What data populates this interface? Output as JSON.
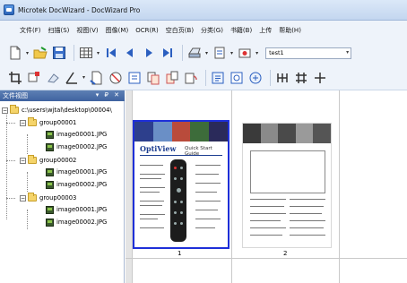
{
  "window": {
    "title": "Microtek DocWizard - DocWizard Pro"
  },
  "menu": [
    "文件(F)",
    "扫描(S)",
    "视图(V)",
    "图像(M)",
    "OCR(R)",
    "空白页(B)",
    "分类(G)",
    "书籍(B)",
    "上传",
    "帮助(H)"
  ],
  "toolbar": {
    "profile_value": "test1"
  },
  "panel": {
    "title": "文件视图",
    "controls": "▾ ₽ ✕"
  },
  "tree": {
    "root": "c:\\users\\wjtal\\desktop\\00004\\",
    "groups": [
      {
        "label": "group00001",
        "files": [
          "image00001.JPG",
          "image00002.JPG"
        ]
      },
      {
        "label": "group00002",
        "files": [
          "image00001.JPG",
          "image00002.JPG"
        ]
      },
      {
        "label": "group00003",
        "files": [
          "image00001.JPG",
          "image00002.JPG"
        ]
      }
    ]
  },
  "thumbnails": [
    {
      "number": "1",
      "brand": "OptiView",
      "heading": "Quick Start Guide",
      "selected": true
    },
    {
      "number": "2",
      "selected": false
    }
  ],
  "colors": {
    "selection": "#1e2fd8",
    "panel_header": "#4a6ea8"
  }
}
